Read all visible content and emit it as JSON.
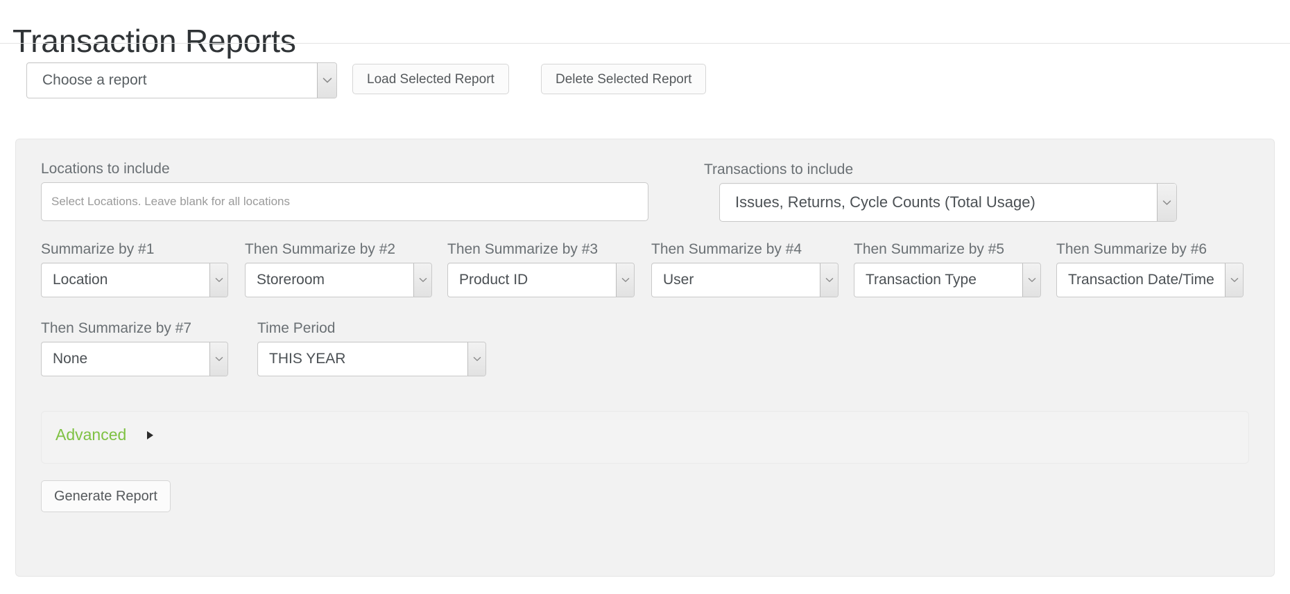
{
  "page": {
    "title": "Transaction Reports"
  },
  "toolbar": {
    "report_picker": {
      "selected": "Choose a report",
      "icon": "chevron-down-icon"
    },
    "load_label": "Load Selected Report",
    "delete_label": "Delete Selected Report"
  },
  "filters": {
    "locations": {
      "label": "Locations to include",
      "value": "",
      "placeholder": "Select Locations. Leave blank for all locations"
    },
    "transactions": {
      "label": "Transactions to include",
      "selected": "Issues, Returns, Cycle Counts (Total Usage)"
    }
  },
  "summarize": [
    {
      "label": "Summarize by #1",
      "selected": "Location"
    },
    {
      "label": "Then Summarize by #2",
      "selected": "Storeroom"
    },
    {
      "label": "Then Summarize by #3",
      "selected": "Product ID"
    },
    {
      "label": "Then Summarize by #4",
      "selected": "User"
    },
    {
      "label": "Then Summarize by #5",
      "selected": "Transaction Type"
    },
    {
      "label": "Then Summarize by #6",
      "selected": "Transaction Date/Time"
    },
    {
      "label": "Then Summarize by #7",
      "selected": "None"
    }
  ],
  "time_period": {
    "label": "Time Period",
    "selected": "THIS YEAR"
  },
  "advanced": {
    "label": "Advanced",
    "caret_icon": "caret-right-icon",
    "expanded": false
  },
  "actions": {
    "generate_label": "Generate Report"
  },
  "colors": {
    "accent_green": "#7ec143",
    "panel_bg": "#f2f2f2",
    "text": "#4b5054",
    "label_text": "#6a7074"
  }
}
